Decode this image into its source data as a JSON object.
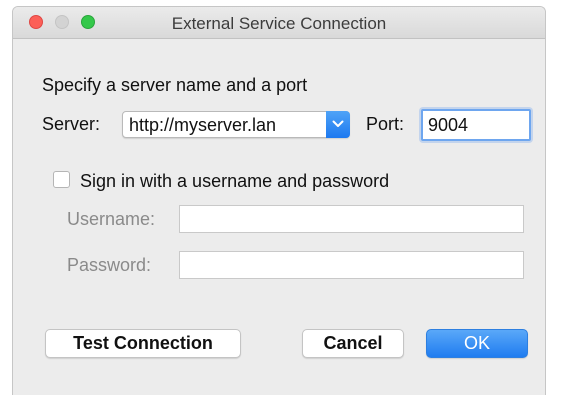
{
  "window": {
    "title": "External Service Connection"
  },
  "form": {
    "heading": "Specify a server name and a port",
    "server_label": "Server:",
    "server_value": "http://myserver.lan",
    "port_label": "Port:",
    "port_value": "9004",
    "signin_checkbox_label": "Sign in with a username and password",
    "signin_checked": false,
    "username_label": "Username:",
    "username_value": "",
    "password_label": "Password:",
    "password_value": ""
  },
  "buttons": {
    "test_connection": "Test Connection",
    "cancel": "Cancel",
    "ok": "OK"
  },
  "colors": {
    "accent": "#1f7cf0",
    "close": "#fc5f57",
    "minimize": "#d3d3d3",
    "zoom": "#34c84a"
  }
}
